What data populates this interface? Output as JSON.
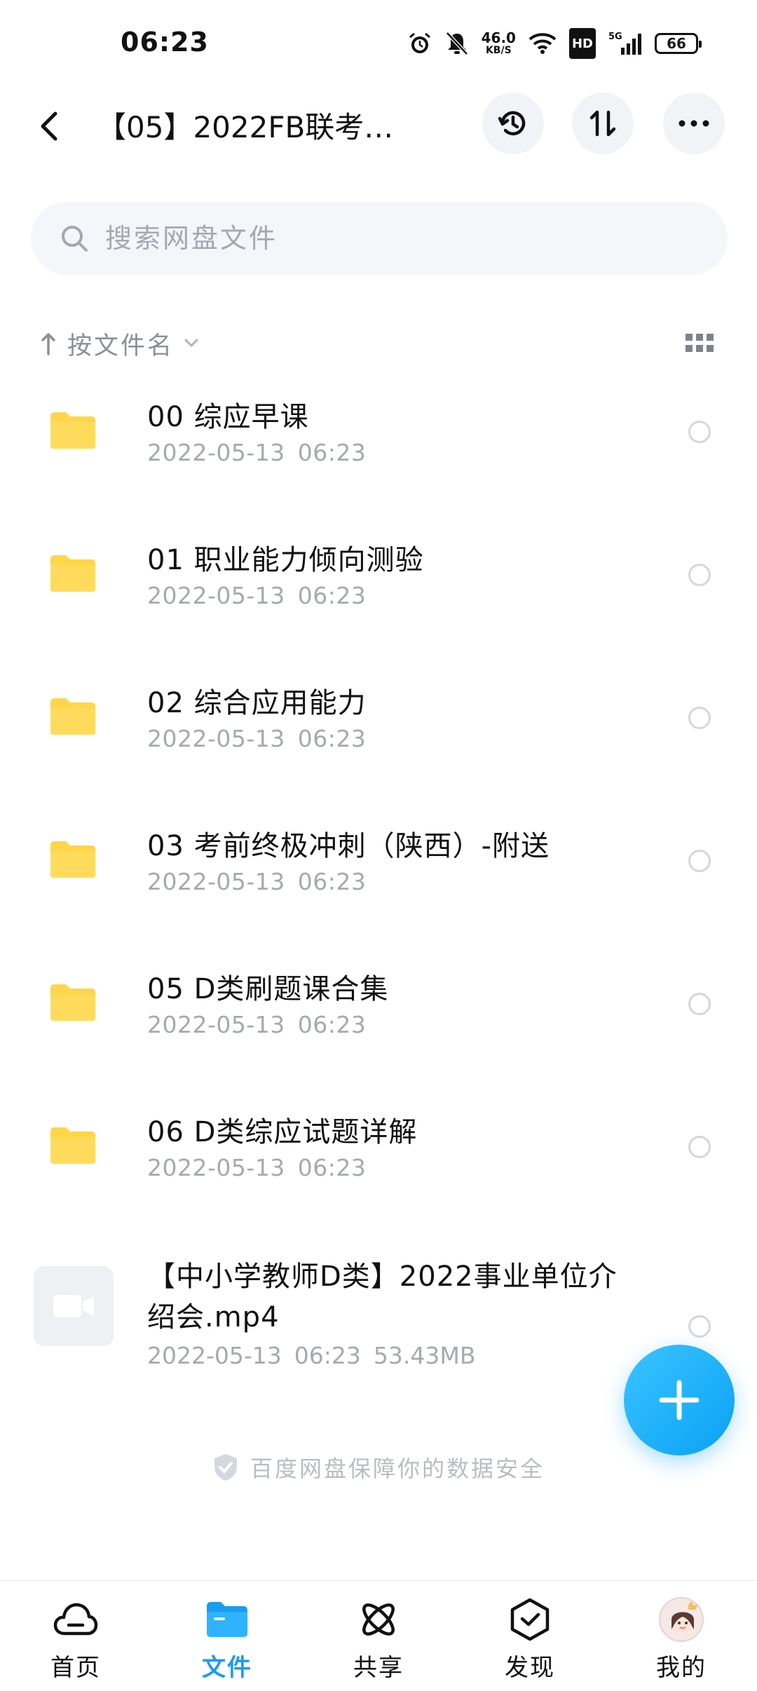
{
  "status_bar": {
    "time": "06:23",
    "net_speed": "46.0",
    "net_unit": "KB/S",
    "hd": "HD",
    "signal": "5G",
    "battery": "66"
  },
  "header": {
    "title": "【05】2022FB联考…"
  },
  "search": {
    "placeholder": "搜索网盘文件"
  },
  "sort": {
    "label": "按文件名"
  },
  "folders": [
    {
      "name": "00 综应早课",
      "date": "2022-05-13",
      "time": "06:23"
    },
    {
      "name": "01 职业能力倾向测验",
      "date": "2022-05-13",
      "time": "06:23"
    },
    {
      "name": "02 综合应用能力",
      "date": "2022-05-13",
      "time": "06:23"
    },
    {
      "name": "03 考前终极冲刺（陕西）-附送",
      "date": "2022-05-13",
      "time": "06:23"
    },
    {
      "name": "05 D类刷题课合集",
      "date": "2022-05-13",
      "time": "06:23"
    },
    {
      "name": "06 D类综应试题详解",
      "date": "2022-05-13",
      "time": "06:23"
    }
  ],
  "video": {
    "name": "【中小学教师D类】2022事业单位介绍会.mp4",
    "date": "2022-05-13",
    "time": "06:23",
    "size": "53.43MB"
  },
  "footer": {
    "safety_text": "百度网盘保障你的数据安全"
  },
  "nav": {
    "home": "首页",
    "files": "文件",
    "share": "共享",
    "discover": "发现",
    "mine": "我的"
  },
  "colors": {
    "accent": "#1a9cf0",
    "folder": "#ffd54a",
    "fab": "#16adf7"
  }
}
